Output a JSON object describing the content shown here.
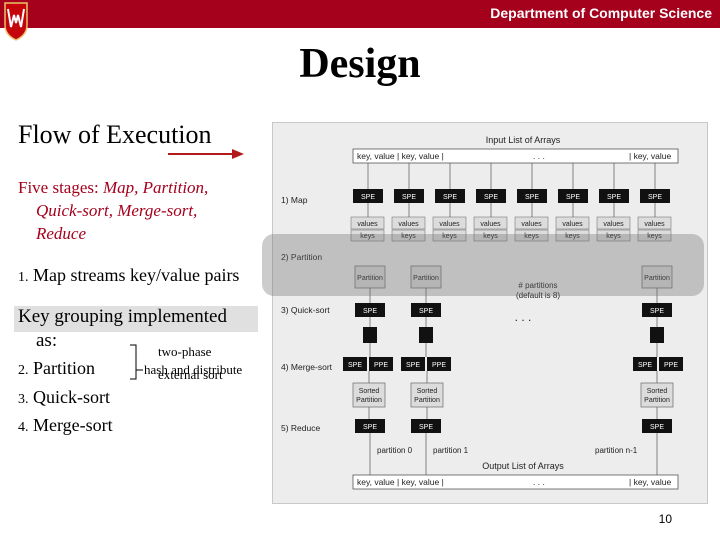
{
  "header": {
    "department": "Department of Computer Science"
  },
  "slide": {
    "title": "Design",
    "subtitle": "Flow of Execution",
    "stages_prefix": "Five stages: ",
    "stages_line1": "Map, Partition,",
    "stages_line2": "Quick-sort, Merge-sort,",
    "stages_line3": "Reduce",
    "item1_num": "1.",
    "item1_text": "Map streams key/value pairs",
    "key_grouping": "Key grouping implemented",
    "key_grouping_as": "as:",
    "item2_num": "2.",
    "item2_text": "Partition",
    "item2_note": "hash and distribute",
    "item3_num": "3.",
    "item3_text": "Quick-sort",
    "item3_note": "two-phase",
    "item4_num": "4.",
    "item4_text": "Merge-sort",
    "item4_note": "external sort",
    "page_number": "10"
  },
  "figure": {
    "input_title": "Input List of Arrays",
    "input_row": "key, value | key, value |",
    "input_dots": ". . .",
    "input_end": "| key, value",
    "stage1": "1) Map",
    "stage2": "2) Partition",
    "stage3": "3) Quick-sort",
    "stage4": "4) Merge-sort",
    "stage5": "5) Reduce",
    "spe": "SPE",
    "ppe": "PPE",
    "values": "values",
    "keys": "keys",
    "partition": "Partition",
    "num_partitions": "# partitions",
    "default_is": "(default is 8)",
    "sorted": "Sorted",
    "partition_label_0": "partition 0",
    "partition_label_1": "partition 1",
    "partition_label_n": "partition n-1",
    "output_title": "Output List of Arrays",
    "output_row": "key, value | key, value |",
    "output_dots": ". . .",
    "output_end": "| key, value",
    "mid_dots": ". . ."
  },
  "colors": {
    "banner": "#a5001c",
    "stage_text": "#a5001c",
    "arrow": "#b31b1b",
    "spe_box": "#111111"
  }
}
